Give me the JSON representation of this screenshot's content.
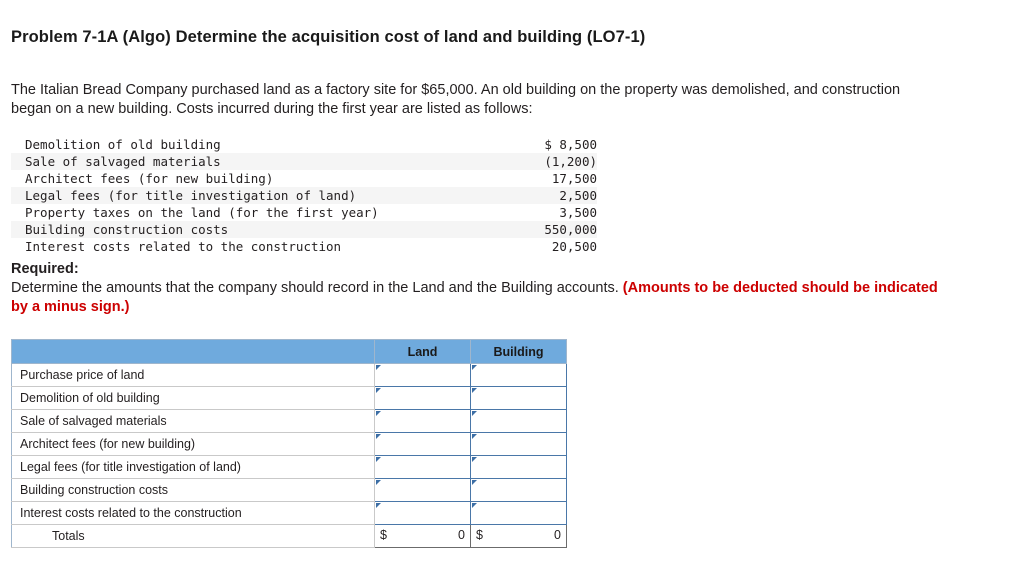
{
  "title": "Problem 7-1A (Algo) Determine the acquisition cost of land and building (LO7-1)",
  "intro": "The Italian Bread Company purchased land as a factory site for $65,000. An old building on the property was demolished, and construction began on a new building. Costs incurred during the first year are listed as follows:",
  "costs": [
    {
      "label": "Demolition of old building",
      "amount": "$ 8,500"
    },
    {
      "label": "Sale of salvaged materials",
      "amount": "(1,200)"
    },
    {
      "label": "Architect fees (for new building)",
      "amount": "17,500"
    },
    {
      "label": "Legal fees (for title investigation of land)",
      "amount": "2,500"
    },
    {
      "label": "Property taxes on the land (for the first year)",
      "amount": "3,500"
    },
    {
      "label": "Building construction costs",
      "amount": "550,000"
    },
    {
      "label": "Interest costs related to the construction",
      "amount": "20,500"
    }
  ],
  "required": {
    "label": "Required:",
    "text": "Determine the amounts that the company should record in the Land and the Building accounts. ",
    "note": "(Amounts to be deducted should be indicated by a minus sign.)"
  },
  "answer_table": {
    "headers": {
      "blank": "",
      "land": "Land",
      "building": "Building"
    },
    "rows": [
      {
        "label": "Purchase price of land",
        "land": "",
        "building": ""
      },
      {
        "label": "Demolition of old building",
        "land": "",
        "building": ""
      },
      {
        "label": "Sale of salvaged materials",
        "land": "",
        "building": ""
      },
      {
        "label": "Architect fees (for new building)",
        "land": "",
        "building": ""
      },
      {
        "label": "Legal fees (for title investigation of land)",
        "land": "",
        "building": ""
      },
      {
        "label": "Building construction costs",
        "land": "",
        "building": ""
      },
      {
        "label": "Interest costs related to the construction",
        "land": "",
        "building": ""
      }
    ],
    "totals": {
      "label": "Totals",
      "land_symbol": "$",
      "land_value": "0",
      "building_symbol": "$",
      "building_value": "0"
    }
  },
  "colors": {
    "header_blue": "#6faadd",
    "note_red": "#cc0000",
    "input_border": "#4a77a8"
  }
}
